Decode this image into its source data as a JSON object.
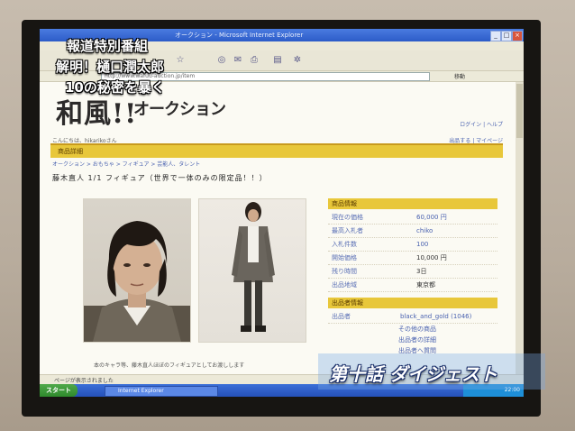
{
  "browser": {
    "title": "オークション - Microsoft Internet Explorer",
    "address": "http://www.wafuu-auction.jp/item",
    "go_label": "移動",
    "status_text": "ページが表示されました",
    "start_label": "スタート",
    "task_label": "Internet Explorer",
    "tray_time": "22:00"
  },
  "site": {
    "logo_main": "和風!!",
    "logo_sub": "オークション",
    "header_links": "ログイン | ヘルプ",
    "greeting": "こんにちは、hikarikoさん",
    "greeting_links": "出品する | マイページ",
    "section_label": "商品詳細",
    "breadcrumb": "オークション > おもちゃ > フィギュア > 芸能人、タレント",
    "item_title": "藤木直人 1/1 フィギュア（世界で一体のみの限定品！！）"
  },
  "item_info": {
    "heading": "商品情報",
    "rows": [
      {
        "label": "現在の価格",
        "value": "60,000 円"
      },
      {
        "label": "最高入札者",
        "value": "chiko"
      },
      {
        "label": "入札件数",
        "value": "100"
      },
      {
        "label": "開始価格",
        "value": "10,000 円"
      },
      {
        "label": "残り時間",
        "value": "3日"
      },
      {
        "label": "出品地域",
        "value": "東京都"
      }
    ]
  },
  "seller_info": {
    "heading": "出品者情報",
    "seller_label": "出品者",
    "seller_name": "black_and_gold (1046)",
    "links": [
      "その他の商品",
      "出品者の詳細",
      "出品者へ質問"
    ]
  },
  "caption": "本のキャラ等、藤木直人ほぼのフィギュアとしてお渡しします",
  "overlay": {
    "line1": "報道特別番組",
    "line2": "解明！樋口潤太郎",
    "line3": "10の秘密を暴く",
    "digest": "第十話 ダイジェスト"
  }
}
